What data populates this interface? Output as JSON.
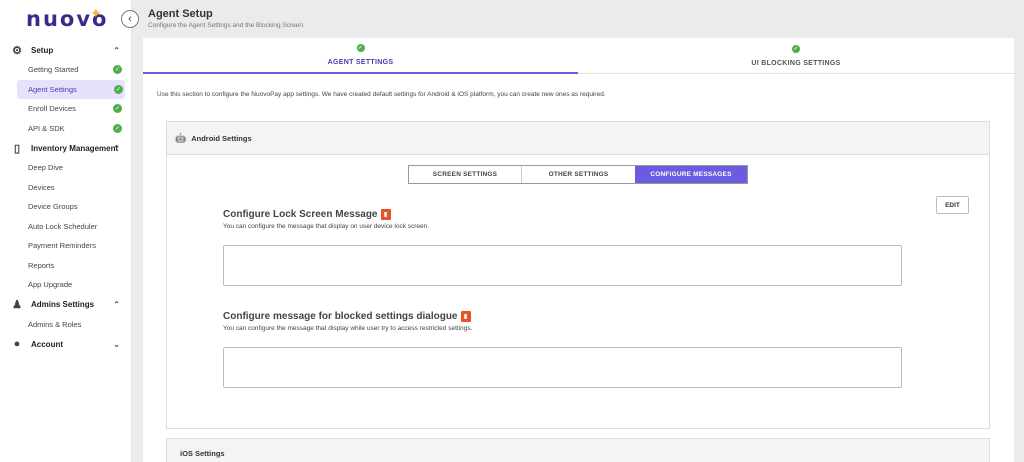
{
  "brand": {
    "name": "nuovo",
    "accent": "#6a5be0",
    "star_color": "#f5b82e"
  },
  "sidebar": {
    "collapse_icon": "chevron-left-icon",
    "groups": [
      {
        "label": "Setup",
        "icon": "gear-icon",
        "expanded": true,
        "items": [
          {
            "label": "Getting Started",
            "done": true
          },
          {
            "label": "Agent Settings",
            "done": true,
            "active": true
          },
          {
            "label": "Enroll Devices",
            "done": true
          },
          {
            "label": "API & SDK",
            "done": true
          }
        ]
      },
      {
        "label": "Inventory Management",
        "icon": "mobile-icon",
        "expanded": true,
        "items": [
          {
            "label": "Deep Dive"
          },
          {
            "label": "Devices"
          },
          {
            "label": "Device Groups"
          },
          {
            "label": "Auto Lock Scheduler"
          },
          {
            "label": "Payment Reminders"
          },
          {
            "label": "Reports"
          },
          {
            "label": "App Upgrade"
          }
        ]
      },
      {
        "label": "Admins Settings",
        "icon": "person-icon",
        "expanded": true,
        "items": [
          {
            "label": "Admins & Roles"
          }
        ]
      },
      {
        "label": "Account",
        "icon": "account-circle-icon",
        "expanded": false,
        "items": []
      }
    ]
  },
  "header": {
    "title": "Agent Setup",
    "subtitle": "Configure the Agent Settings and the Blocking Screen."
  },
  "tabs": [
    {
      "label": "AGENT SETTINGS",
      "active": true,
      "done": true
    },
    {
      "label": "UI BLOCKING SETTINGS",
      "active": false,
      "done": true
    }
  ],
  "intro": "Use this section to configure the NuovoPay app settings. We have created default settings for Android & iOS platform, you can create new ones as required.",
  "android": {
    "title": "Android Settings",
    "segments": [
      "SCREEN SETTINGS",
      "OTHER SETTINGS",
      "CONFIGURE MESSAGES"
    ],
    "active_segment": "CONFIGURE MESSAGES",
    "edit_label": "EDIT",
    "lock_message": {
      "title": "Configure Lock Screen Message",
      "description": "You can configure the message that display on user device lock screen.",
      "value": ""
    },
    "blocked_message": {
      "title": "Configure message for blocked settings dialogue",
      "description": "You can configure the message that display while user try to access restricted settings.",
      "value": ""
    }
  },
  "ios": {
    "title": "iOS Settings"
  }
}
